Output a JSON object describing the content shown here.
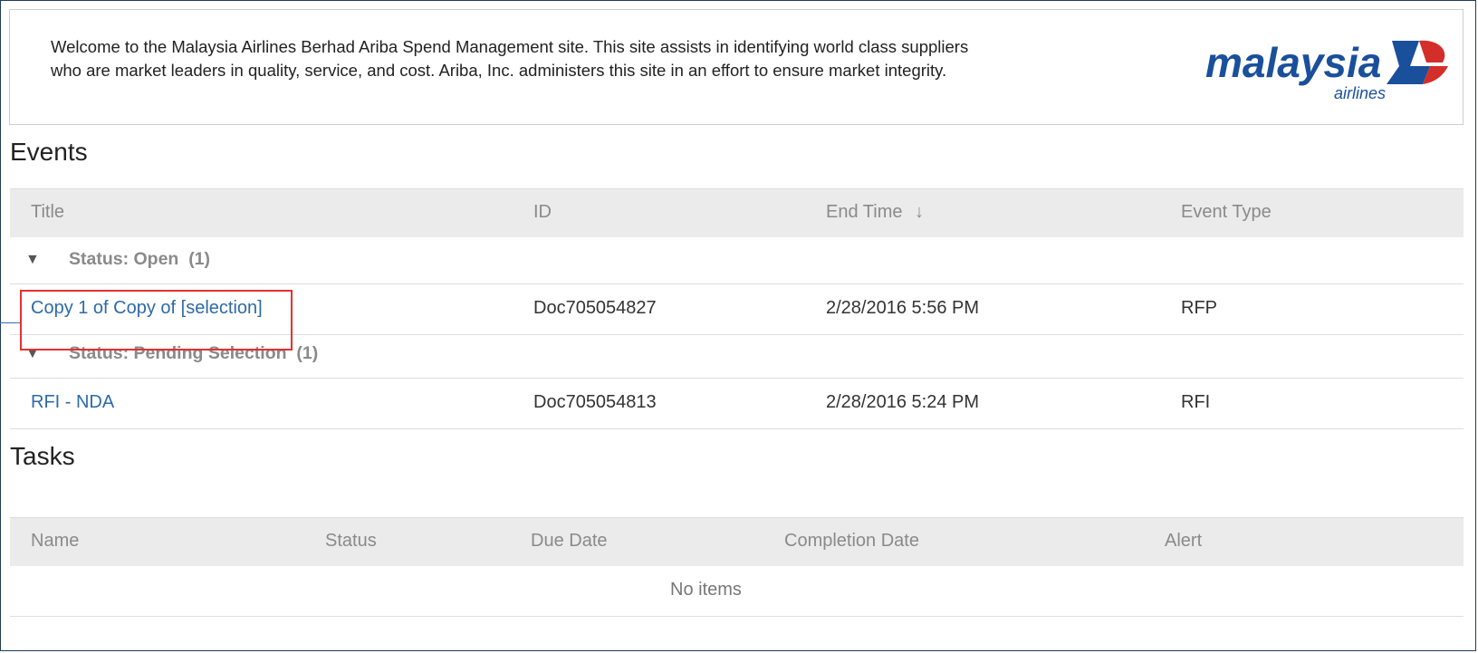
{
  "welcome": {
    "line1": "Welcome to the Malaysia Airlines Berhad Ariba Spend Management site. This site assists in identifying world class suppliers",
    "line2": "who are market leaders in quality, service, and cost. Ariba, Inc. administers this site in an effort to ensure market integrity.",
    "logo_text": "malaysia",
    "logo_subtext": "airlines",
    "brand_color": "#1a4f9c",
    "brand_accent": "#d42e2a"
  },
  "events": {
    "title": "Events",
    "columns": [
      "Title",
      "ID",
      "End Time",
      "Event Type"
    ],
    "sort_icon": "arrow-down-icon",
    "groups": [
      {
        "label": "Status: Open",
        "count": "(1)",
        "rows": [
          {
            "title": "Copy 1 of Copy of [selection]",
            "id": "Doc705054827",
            "end_time": "2/28/2016 5:56 PM",
            "type": "RFP"
          }
        ]
      },
      {
        "label": "Status: Pending Selection",
        "count": "(1)",
        "rows": [
          {
            "title": "RFI - NDA",
            "id": "Doc705054813",
            "end_time": "2/28/2016 5:24 PM",
            "type": "RFI"
          }
        ]
      }
    ]
  },
  "tasks": {
    "title": "Tasks",
    "columns": [
      "Name",
      "Status",
      "Due Date",
      "Completion Date",
      "Alert"
    ],
    "empty_text": "No items"
  },
  "colors": {
    "highlight": "#e53030",
    "link": "#2d6aa8",
    "header_bg": "#ebebeb"
  }
}
